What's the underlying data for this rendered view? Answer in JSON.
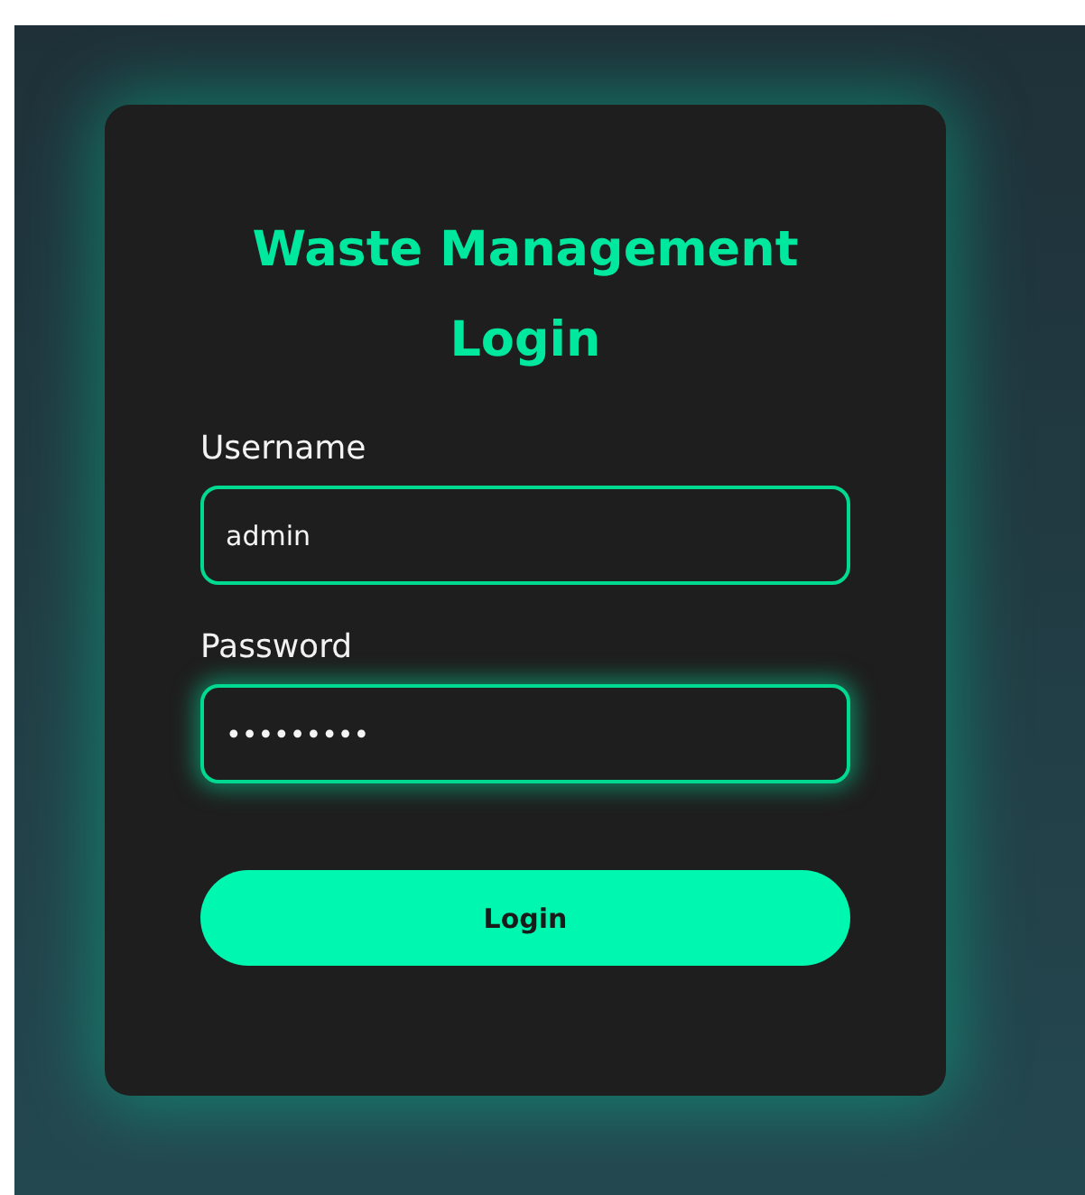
{
  "title": "Waste Management Login",
  "fields": [
    {
      "label": "Username",
      "value": "admin",
      "focused": false
    },
    {
      "label": "Password",
      "value": "•••••••••",
      "focused": true
    }
  ],
  "button": "Login"
}
